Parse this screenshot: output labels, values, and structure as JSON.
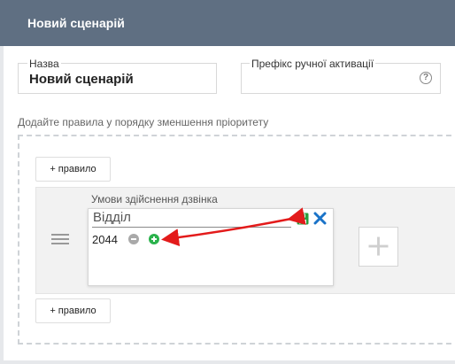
{
  "header": {
    "title": "Новий сценарій"
  },
  "form": {
    "name_label": "Назва",
    "name_value": "Новий сценарій",
    "prefix_label": "Префікс ручної активації",
    "prefix_value": "",
    "help_glyph": "?"
  },
  "rules": {
    "section_label": "Додайте правила у порядку зменшення пріоритету",
    "add_rule_top": "+ правило",
    "add_rule_bottom": "+ правило",
    "conditions_label": "Умови здійснення дзвінка",
    "condition_field": "Відділ",
    "values": [
      "2044"
    ]
  },
  "icons": [
    "save-icon",
    "close-icon",
    "remove-value-icon",
    "add-value-icon",
    "add-condition-icon",
    "drag-handle-icon",
    "help-icon"
  ],
  "colors": {
    "header_bg": "#5f6f82",
    "save": "#2a9d3e",
    "close": "#1a73c8",
    "add_value": "#2bb24c",
    "remove_value": "#a9a9a9",
    "annotation_arrow": "#e31b1b"
  }
}
